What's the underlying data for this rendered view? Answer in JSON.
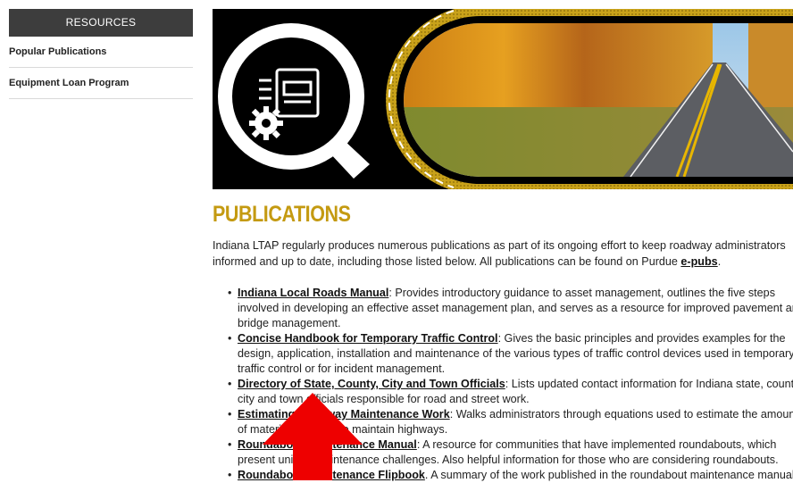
{
  "sidebar": {
    "header": "RESOURCES",
    "items": [
      {
        "label": "Popular Publications"
      },
      {
        "label": "Equipment Loan Program"
      }
    ]
  },
  "banner": {
    "icon": "publications-gear-icon"
  },
  "page": {
    "title": "PUBLICATIONS",
    "intro_text": "Indiana LTAP regularly produces numerous publications as part of its ongoing effort to keep roadway administrators informed and up to date, including those listed below. All publications can be found on Purdue ",
    "intro_link": "e-pubs",
    "intro_end": "."
  },
  "publications": [
    {
      "title": "Indiana Local Roads Manual",
      "desc": ": Provides introductory guidance to asset management, outlines the five steps involved in developing an effective asset management plan, and serves as a resource for improved pavement and bridge management."
    },
    {
      "title": "Concise Handbook for Temporary Traffic Control",
      "desc": ": Gives the basic principles and provides examples for the design, application, installation and maintenance of the various types of traffic control devices used in temporary traffic control or for incident management."
    },
    {
      "title": "Directory of State, County, City and Town Officials",
      "desc": ": Lists updated contact information for Indiana state, county, city and town officials responsible for road and street work."
    },
    {
      "title": "Estimating Roadway Maintenance Work",
      "desc": ": Walks administrators through equations used to estimate the amount of materials needed to maintain highways."
    },
    {
      "title": "Roundabout Maintenance Manual",
      "desc": ": A resource for communities that have implemented roundabouts, which present unique maintenance challenges. Also helpful information for those who are considering roundabouts."
    },
    {
      "title": "Roundabout Maintenance Flipbook",
      "desc": ". A summary of the work published in the roundabout maintenance manual."
    }
  ],
  "colors": {
    "accent_gold": "#c49a11",
    "sidebar_header_bg": "#3d3d3d",
    "arrow_red": "#ee0000"
  }
}
